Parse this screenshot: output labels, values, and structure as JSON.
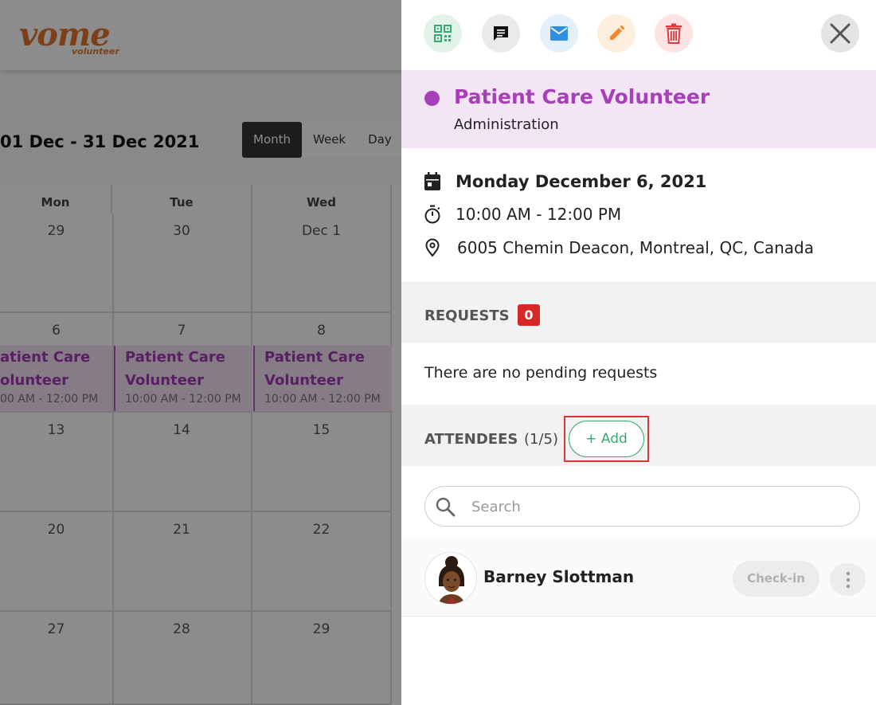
{
  "app": {
    "logo_word": "vome",
    "logo_sub": "volunteer",
    "range_title": "01 Dec - 31 Dec 2021",
    "views": [
      "Month",
      "Week",
      "Day"
    ],
    "active_view": "Month"
  },
  "calendar": {
    "weekdays": [
      "Mon",
      "Tue",
      "Wed"
    ],
    "weeks": [
      [
        "29",
        "30",
        "Dec 1"
      ],
      [
        "6",
        "7",
        "8"
      ],
      [
        "13",
        "14",
        "15"
      ],
      [
        "20",
        "21",
        "22"
      ],
      [
        "27",
        "28",
        "29"
      ]
    ],
    "events": [
      {
        "title_line1": "atient Care",
        "title_line2": "olunteer",
        "time": "00 AM - 12:00 PM"
      },
      {
        "title_line1": "Patient Care",
        "title_line2": "Volunteer",
        "time": "10:00 AM - 12:00 PM"
      },
      {
        "title_line1": "Patient Care",
        "title_line2": "Volunteer",
        "time": "10:00 AM - 12:00 PM"
      }
    ]
  },
  "panel": {
    "toolbar": [
      {
        "name": "qr-code-icon",
        "bg": "#e2f4e9",
        "color": "#3aa871"
      },
      {
        "name": "message-icon",
        "bg": "#eaeaea",
        "color": "#111111"
      },
      {
        "name": "email-icon",
        "bg": "#e1f0fb",
        "color": "#2f8fdc"
      },
      {
        "name": "edit-icon",
        "bg": "#fdeedd",
        "color": "#f08a2c"
      },
      {
        "name": "delete-icon",
        "bg": "#fde4e4",
        "color": "#dd3b3b"
      }
    ],
    "event_name": "Patient Care Volunteer",
    "category": "Administration",
    "date": "Monday December 6, 2021",
    "time": "10:00 AM -  12:00 PM",
    "address": "6005 Chemin Deacon, Montreal, QC, Canada",
    "requests_label": "REQUESTS",
    "requests_count": "0",
    "no_requests": "There are no pending requests",
    "attendees_label": "ATTENDEES",
    "attendees_count": "(1/5)",
    "add_label": "+ Add",
    "search_placeholder": "Search",
    "attendees": [
      {
        "name": "Barney Slottman",
        "checkin_label": "Check-in"
      }
    ],
    "colors": {
      "accent": "#a73fba",
      "accent_band": "#f3e5f5",
      "success": "#3aa871",
      "danger": "#d92727"
    }
  }
}
